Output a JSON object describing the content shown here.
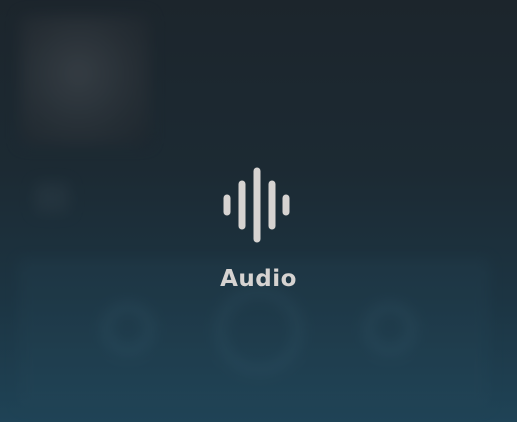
{
  "overlay": {
    "label": "Audio",
    "icon": "audio-waveform-icon",
    "color": "#d6d3d1"
  },
  "colors": {
    "background_top": "#1c252c",
    "background_bottom": "#1f4356"
  }
}
